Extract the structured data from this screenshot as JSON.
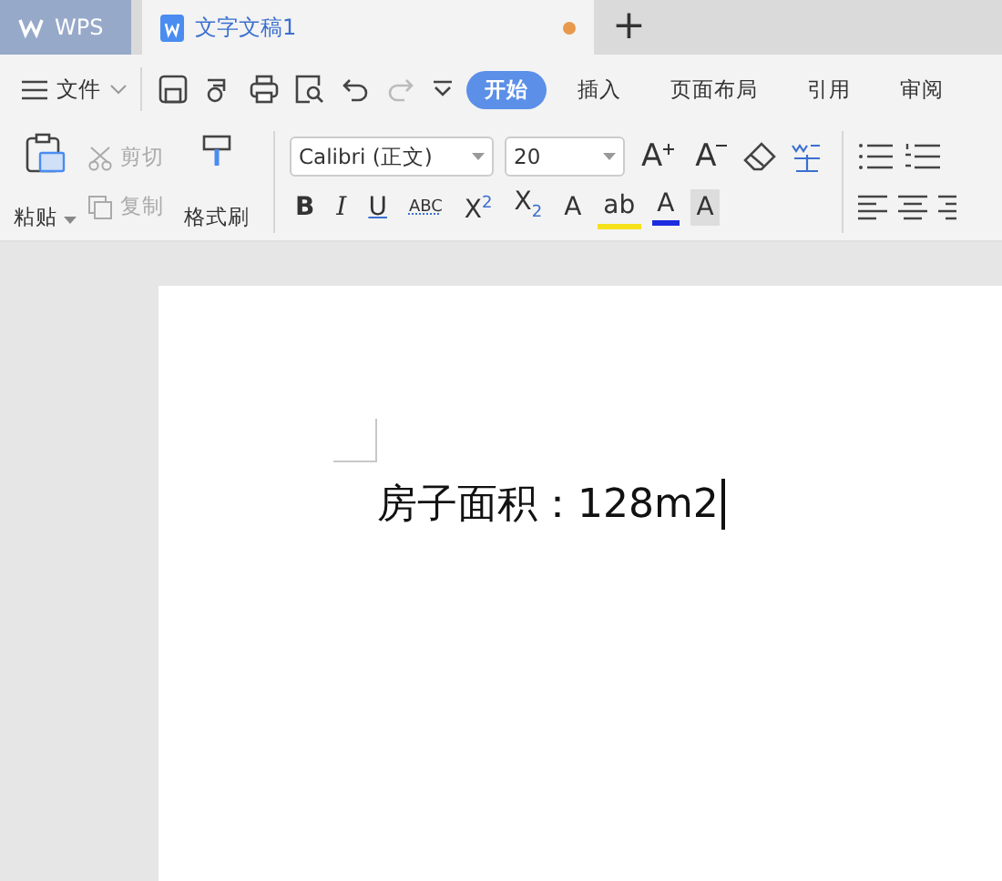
{
  "tabs": [
    {
      "label": "WPS",
      "kind": "home",
      "selected": false
    },
    {
      "label": "文字文稿1",
      "kind": "doc",
      "selected": true,
      "unsaved": true
    }
  ],
  "new_tab": "+",
  "menu": {
    "file": "文件",
    "tabs": [
      {
        "label": "开始",
        "selected": true
      },
      {
        "label": "插入",
        "selected": false
      },
      {
        "label": "页面布局",
        "selected": false
      },
      {
        "label": "引用",
        "selected": false
      },
      {
        "label": "审阅",
        "selected": false
      }
    ]
  },
  "clipboard": [
    {
      "label": "剪切",
      "disabled": true
    },
    {
      "label": "复制",
      "disabled": true
    }
  ],
  "paste": "粘贴",
  "format_painter": "格式刷",
  "font_name": "Calibri (正文)",
  "font_size": "20",
  "size_buttons": [
    "A",
    "A"
  ],
  "format_buttons": [
    {
      "glyph": "B",
      "kind": "bold"
    },
    {
      "glyph": "I",
      "kind": "italic"
    },
    {
      "glyph": "U",
      "kind": "underline"
    },
    {
      "glyph": "ABC",
      "kind": "strike"
    },
    {
      "glyph": "X",
      "kind": "sup",
      "index": "2"
    },
    {
      "glyph": "X",
      "kind": "sub",
      "index": "2"
    },
    {
      "glyph": "A",
      "kind": "effect"
    },
    {
      "glyph": "ab",
      "kind": "highlight"
    },
    {
      "glyph": "A",
      "kind": "color"
    },
    {
      "glyph": "A",
      "kind": "shade"
    }
  ],
  "document": {
    "text": "房子面积：128m2"
  }
}
